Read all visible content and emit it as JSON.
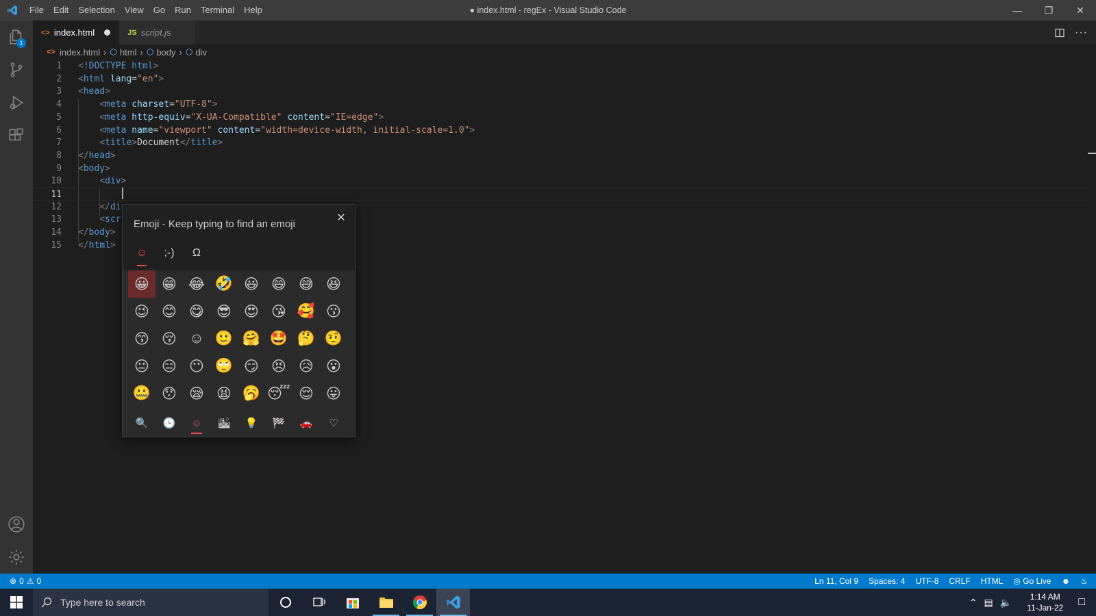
{
  "window": {
    "title": "● index.html - regEx - Visual Studio Code",
    "menu": [
      "File",
      "Edit",
      "Selection",
      "View",
      "Go",
      "Run",
      "Terminal",
      "Help"
    ]
  },
  "activity": {
    "explorer_badge": "1"
  },
  "tabs": [
    {
      "label": "index.html",
      "icon": "<>",
      "modified": true,
      "active": true
    },
    {
      "label": "script.js",
      "icon": "JS",
      "modified": false,
      "active": false
    }
  ],
  "breadcrumb": [
    "index.html",
    "html",
    "body",
    "div"
  ],
  "code_lines": [
    {
      "n": "1",
      "text": "<!DOCTYPE html>"
    },
    {
      "n": "2",
      "text": "<html lang=\"en\">"
    },
    {
      "n": "3",
      "text": "<head>"
    },
    {
      "n": "4",
      "text": "    <meta charset=\"UTF-8\">"
    },
    {
      "n": "5",
      "text": "    <meta http-equiv=\"X-UA-Compatible\" content=\"IE=edge\">"
    },
    {
      "n": "6",
      "text": "    <meta name=\"viewport\" content=\"width=device-width, initial-scale=1.0\">"
    },
    {
      "n": "7",
      "text": "    <title>Document</title>"
    },
    {
      "n": "8",
      "text": "</head>"
    },
    {
      "n": "9",
      "text": "<body>"
    },
    {
      "n": "10",
      "text": "    <div>"
    },
    {
      "n": "11",
      "text": "        "
    },
    {
      "n": "12",
      "text": "    </di"
    },
    {
      "n": "13",
      "text": "    <scr"
    },
    {
      "n": "14",
      "text": "</body>"
    },
    {
      "n": "15",
      "text": "</html>"
    }
  ],
  "current_line": "11",
  "emoji_panel": {
    "title": "Emoji - Keep typing to find an emoji",
    "tabs": [
      "☺",
      ";-)",
      "Ω"
    ],
    "emojis": [
      "😀",
      "😁",
      "😂",
      "🤣",
      "😃",
      "😄",
      "😅",
      "😆",
      "😉",
      "😊",
      "😋",
      "😎",
      "😍",
      "😘",
      "🥰",
      "😗",
      "😙",
      "😚",
      "☺",
      "🙂",
      "🤗",
      "🤩",
      "🤔",
      "🤨",
      "😐",
      "😑",
      "😶",
      "🙄",
      "😏",
      "😣",
      "😥",
      "😮",
      "🤐",
      "😯",
      "😪",
      "😫",
      "🥱",
      "😴",
      "😌",
      "😛"
    ],
    "footer": [
      "🔍",
      "🕓",
      "☺",
      "🏙",
      "💡",
      "🏁",
      "🚗",
      "♡"
    ]
  },
  "status": {
    "errors": "0",
    "warnings": "0",
    "position": "Ln 11, Col 9",
    "spaces": "Spaces: 4",
    "encoding": "UTF-8",
    "eol": "CRLF",
    "language": "HTML",
    "golive": "Go Live"
  },
  "taskbar": {
    "search_placeholder": "Type here to search",
    "time": "1:14 AM",
    "date": "11-Jan-22"
  },
  "colors": {
    "accent": "#007acc",
    "tag": "#569cd6",
    "attr": "#9cdcfe",
    "string": "#ce9178",
    "emoji_accent": "#e24c4c"
  }
}
